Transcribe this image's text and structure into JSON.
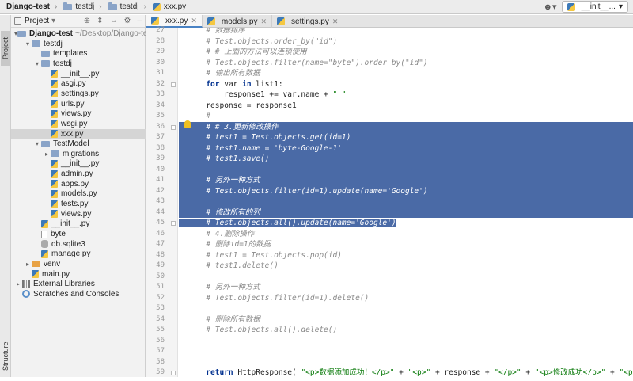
{
  "navbar": {
    "crumbs": [
      "Django-test",
      "testdj",
      "testdj",
      "xxx.py"
    ],
    "user_icon": "user-icon",
    "run_config": "__init__..."
  },
  "side_tabs": {
    "project": "Project",
    "structure": "Structure"
  },
  "project_panel": {
    "title": "Project",
    "tree": [
      {
        "label": "Django-test",
        "extra": "~/Desktop/Django-test",
        "type": "folder",
        "level": 0,
        "open": true,
        "bold": true
      },
      {
        "label": "testdj",
        "type": "folder",
        "level": 1,
        "open": true
      },
      {
        "label": "templates",
        "type": "folder",
        "level": 2
      },
      {
        "label": "testdj",
        "type": "folder",
        "level": 2,
        "open": true
      },
      {
        "label": "__init__.py",
        "type": "py",
        "level": 3
      },
      {
        "label": "asgi.py",
        "type": "py",
        "level": 3
      },
      {
        "label": "settings.py",
        "type": "py",
        "level": 3
      },
      {
        "label": "urls.py",
        "type": "py",
        "level": 3
      },
      {
        "label": "views.py",
        "type": "py",
        "level": 3
      },
      {
        "label": "wsgi.py",
        "type": "py",
        "level": 3
      },
      {
        "label": "xxx.py",
        "type": "py",
        "level": 3,
        "selected": true
      },
      {
        "label": "TestModel",
        "type": "folder",
        "level": 2,
        "open": true
      },
      {
        "label": "migrations",
        "type": "folder",
        "level": 3,
        "closed": true
      },
      {
        "label": "__init__.py",
        "type": "py",
        "level": 3
      },
      {
        "label": "admin.py",
        "type": "py",
        "level": 3
      },
      {
        "label": "apps.py",
        "type": "py",
        "level": 3
      },
      {
        "label": "models.py",
        "type": "py",
        "level": 3
      },
      {
        "label": "tests.py",
        "type": "py",
        "level": 3
      },
      {
        "label": "views.py",
        "type": "py",
        "level": 3
      },
      {
        "label": "__init__.py",
        "type": "py",
        "level": 2
      },
      {
        "label": "byte",
        "type": "plain",
        "level": 2
      },
      {
        "label": "db.sqlite3",
        "type": "db",
        "level": 2
      },
      {
        "label": "manage.py",
        "type": "py",
        "level": 2
      },
      {
        "label": "venv",
        "type": "folder-orange",
        "level": 1,
        "closed": true
      },
      {
        "label": "main.py",
        "type": "py",
        "level": 1
      },
      {
        "label": "External Libraries",
        "type": "lib",
        "level": 0,
        "closed": true
      },
      {
        "label": "Scratches and Consoles",
        "type": "scratch",
        "level": 0
      }
    ]
  },
  "editor": {
    "tabs": [
      {
        "label": "xxx.py",
        "active": true
      },
      {
        "label": "models.py",
        "active": false
      },
      {
        "label": "settings.py",
        "active": false
      }
    ],
    "lines": [
      {
        "n": "27",
        "text": "# 数据排序",
        "kind": "cmt",
        "indent": 4
      },
      {
        "n": "28",
        "text": "# Test.objects.order_by(\"id\")",
        "kind": "cmt",
        "indent": 4
      },
      {
        "n": "29",
        "text": "# # 上面的方法可以连锁使用",
        "kind": "cmt",
        "indent": 4
      },
      {
        "n": "30",
        "text": "# Test.objects.filter(name=\"byte\").order_by(\"id\")",
        "kind": "cmt",
        "indent": 4
      },
      {
        "n": "31",
        "text": "# 输出所有数据",
        "kind": "cmt",
        "indent": 4
      },
      {
        "n": "32",
        "text": "for var in list1:",
        "kind": "code",
        "indent": 4
      },
      {
        "n": "33",
        "text": "response1 += var.name + \" \"",
        "kind": "code",
        "indent": 8
      },
      {
        "n": "34",
        "text": "response = response1",
        "kind": "code",
        "indent": 4
      },
      {
        "n": "35",
        "text": "#",
        "kind": "cmt",
        "indent": 4
      },
      {
        "n": "36",
        "text": "# # 3.更新修改操作",
        "kind": "cmt",
        "indent": 4,
        "sel": true
      },
      {
        "n": "37",
        "text": "# test1 = Test.objects.get(id=1)",
        "kind": "cmt",
        "indent": 4,
        "sel": true
      },
      {
        "n": "38",
        "text": "# test1.name = 'byte-Google-1'",
        "kind": "cmt",
        "indent": 4,
        "sel": true
      },
      {
        "n": "39",
        "text": "# test1.save()",
        "kind": "cmt",
        "indent": 4,
        "sel": true
      },
      {
        "n": "40",
        "text": "",
        "kind": "cmt",
        "indent": 0,
        "sel": true
      },
      {
        "n": "41",
        "text": "# 另外一种方式",
        "kind": "cmt",
        "indent": 4,
        "sel": true
      },
      {
        "n": "42",
        "text": "# Test.objects.filter(id=1).update(name='Google')",
        "kind": "cmt",
        "indent": 4,
        "sel": true
      },
      {
        "n": "43",
        "text": "",
        "kind": "cmt",
        "indent": 0,
        "sel": true
      },
      {
        "n": "44",
        "text": "# 修改所有的列",
        "kind": "cmt",
        "indent": 4,
        "sel": true
      },
      {
        "n": "45",
        "text": "# Test.objects.all().update(name='Google')",
        "kind": "cmt",
        "indent": 4,
        "sel": "partial"
      },
      {
        "n": "46",
        "text": "# 4.删除操作",
        "kind": "cmt",
        "indent": 4
      },
      {
        "n": "47",
        "text": "# 删除id=1的数据",
        "kind": "cmt",
        "indent": 4
      },
      {
        "n": "48",
        "text": "# test1 = Test.objects.pop(id)",
        "kind": "cmt",
        "indent": 4
      },
      {
        "n": "49",
        "text": "# test1.delete()",
        "kind": "cmt",
        "indent": 4
      },
      {
        "n": "50",
        "text": "",
        "kind": "cmt",
        "indent": 0
      },
      {
        "n": "51",
        "text": "# 另外一种方式",
        "kind": "cmt",
        "indent": 4
      },
      {
        "n": "52",
        "text": "# Test.objects.filter(id=1).delete()",
        "kind": "cmt",
        "indent": 4
      },
      {
        "n": "53",
        "text": "",
        "kind": "cmt",
        "indent": 0
      },
      {
        "n": "54",
        "text": "# 删除所有数据",
        "kind": "cmt",
        "indent": 4
      },
      {
        "n": "55",
        "text": "# Test.objects.all().delete()",
        "kind": "cmt",
        "indent": 4
      },
      {
        "n": "56",
        "text": "",
        "kind": "cmt",
        "indent": 0
      },
      {
        "n": "57",
        "text": "",
        "kind": "cmt",
        "indent": 0
      },
      {
        "n": "58",
        "text": "",
        "kind": "cmt",
        "indent": 0
      },
      {
        "n": "59",
        "text": "return HttpResponse( \"<p>数据添加成功！</p>\" + \"<p>\" + response + \"</p>\" + \"<p>修改成功</p>\" + \"<p>删除成功</p>\")",
        "kind": "code",
        "indent": 4
      }
    ]
  }
}
